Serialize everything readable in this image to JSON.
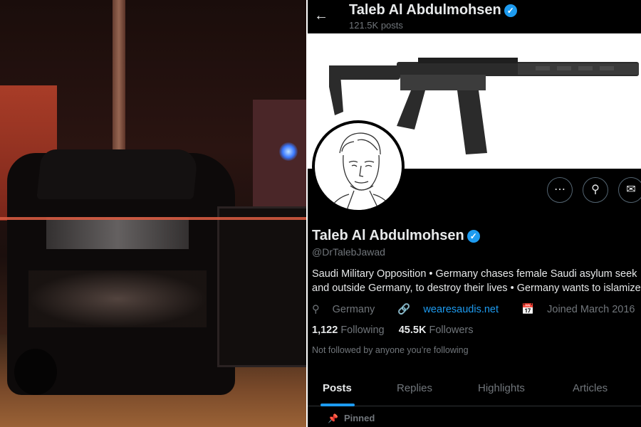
{
  "profile": {
    "display_name": "Taleb Al Abdulmohsen",
    "post_count": "121.5K posts",
    "handle": "@DrTalebJawad",
    "bio_line1": "Saudi Military Opposition • Germany chases female Saudi asylum seek",
    "bio_line2": "and outside Germany, to destroy their lives • Germany wants to islamize",
    "location": "Germany",
    "website": "wearesaudis.net",
    "joined": "Joined March 2016",
    "following_count": "1,122",
    "following_label": "Following",
    "followers_count": "45.5K",
    "followers_label": "Followers",
    "not_followed_text": "Not followed by anyone you’re following"
  },
  "tabs": [
    {
      "label": "Posts",
      "active": true
    },
    {
      "label": "Replies",
      "active": false
    },
    {
      "label": "Highlights",
      "active": false
    },
    {
      "label": "Articles",
      "active": false
    }
  ],
  "pinned_label": "Pinned",
  "icons": {
    "back": "back-arrow-icon",
    "verified": "verified-badge-icon",
    "more": "more-icon",
    "search": "search-icon",
    "message": "mail-icon",
    "location": "location-icon",
    "link": "link-icon",
    "calendar": "calendar-icon",
    "pin": "pin-icon"
  },
  "colors": {
    "accent": "#1d9bf0",
    "background": "#000000",
    "text_primary": "#e7e9ea",
    "text_secondary": "#71767b"
  }
}
